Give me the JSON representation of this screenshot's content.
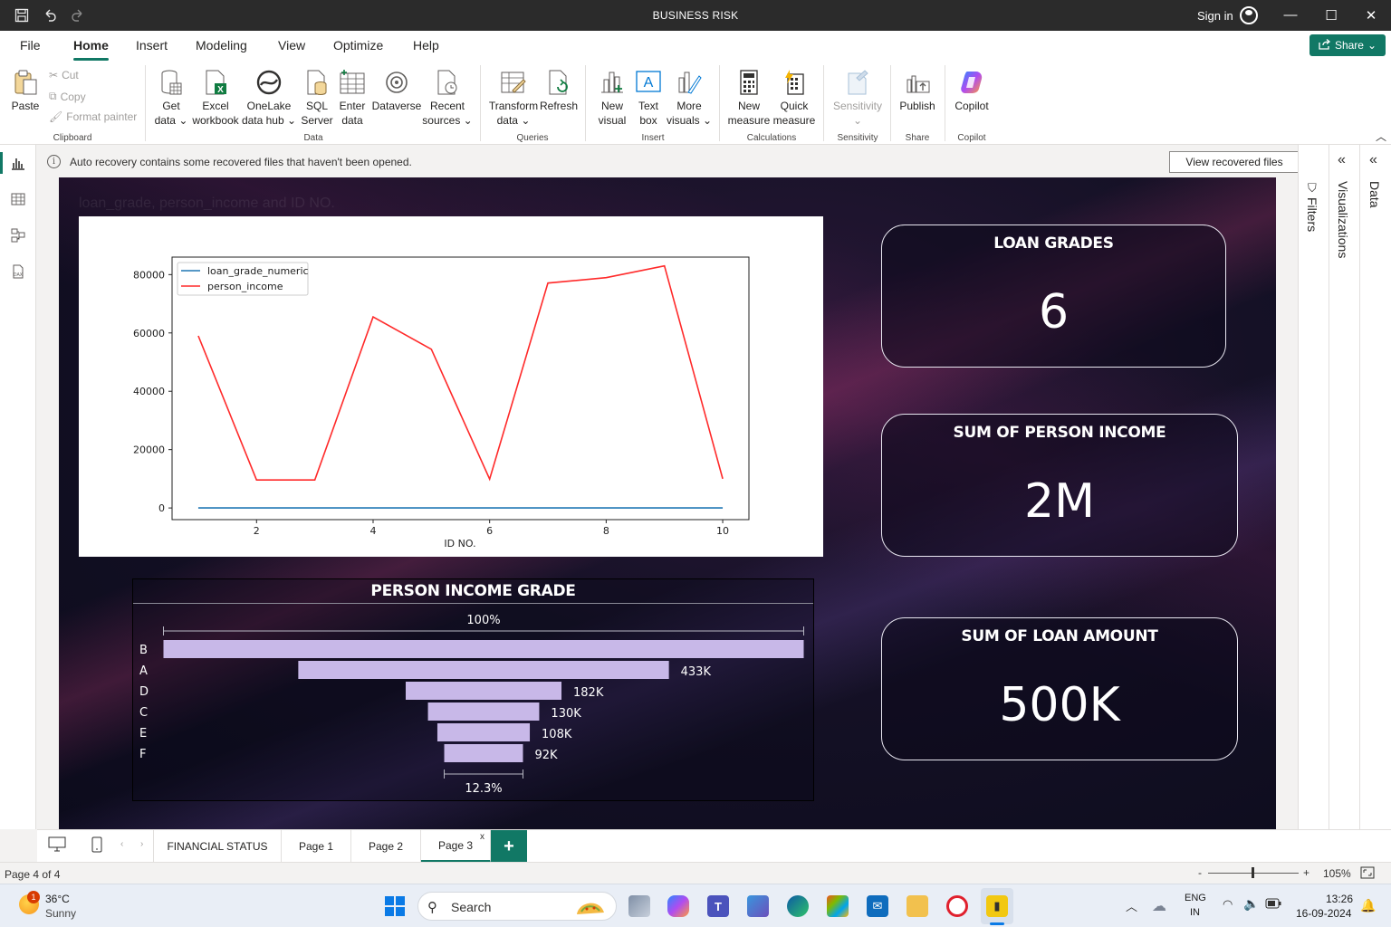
{
  "titlebar": {
    "title": "BUSINESS RISK",
    "signin": "Sign in",
    "minimize": "—",
    "maximize": "☐",
    "close": "✕"
  },
  "menu": {
    "tabs": [
      "File",
      "Home",
      "Insert",
      "Modeling",
      "View",
      "Optimize",
      "Help"
    ],
    "active": "Home",
    "share_label": "Share"
  },
  "ribbon": {
    "clipboard": {
      "paste": "Paste",
      "cut": "Cut",
      "copy": "Copy",
      "format_painter": "Format painter",
      "label": "Clipboard"
    },
    "data": {
      "get_data": [
        "Get",
        "data ⌄"
      ],
      "excel": [
        "Excel",
        "workbook"
      ],
      "onelake": [
        "OneLake",
        "data hub ⌄"
      ],
      "sql": [
        "SQL",
        "Server"
      ],
      "enter": [
        "Enter",
        "data"
      ],
      "dataverse": [
        "Dataverse",
        ""
      ],
      "recent": [
        "Recent",
        "sources ⌄"
      ],
      "label": "Data"
    },
    "queries": {
      "transform": [
        "Transform",
        "data ⌄"
      ],
      "refresh": [
        "Refresh",
        ""
      ],
      "label": "Queries"
    },
    "insert": {
      "new_visual": [
        "New",
        "visual"
      ],
      "text_box": [
        "Text",
        "box"
      ],
      "more_visuals": [
        "More",
        "visuals ⌄"
      ],
      "label": "Insert"
    },
    "calculations": {
      "new_measure": [
        "New",
        "measure"
      ],
      "quick_measure": [
        "Quick",
        "measure"
      ],
      "label": "Calculations"
    },
    "sensitivity": {
      "btn": [
        "Sensitivity",
        "⌄"
      ],
      "label": "Sensitivity"
    },
    "share": {
      "publish": "Publish",
      "label": "Share"
    },
    "copilot": {
      "btn": "Copilot",
      "label": "Copilot"
    }
  },
  "notification": {
    "message": "Auto recovery contains some recovered files that haven't been opened.",
    "button": "View recovered files"
  },
  "panes": {
    "filters": "Filters",
    "visualizations": "Visualizations",
    "data": "Data"
  },
  "canvas": {
    "ghost_title": "loan_grade, person_income and ID NO.",
    "cards": [
      {
        "title": "LOAN GRADES",
        "value": "6"
      },
      {
        "title": "SUM OF PERSON INCOME",
        "value": "2M"
      },
      {
        "title": "SUM OF LOAN AMOUNT",
        "value": "500K"
      }
    ]
  },
  "chart_data": [
    {
      "type": "line",
      "xlabel": "ID NO.",
      "ylabel": "",
      "x": [
        1,
        2,
        3,
        4,
        5,
        6,
        7,
        8,
        9,
        10
      ],
      "xlim": [
        0.55,
        10.45
      ],
      "ylim": [
        -4000,
        86000
      ],
      "x_ticks": [
        2,
        4,
        6,
        8,
        10
      ],
      "y_ticks": [
        0,
        20000,
        40000,
        60000,
        80000
      ],
      "legend_position": "top-left",
      "series": [
        {
          "name": "loan_grade_numeric",
          "color": "#1f77b4",
          "values": [
            0,
            0,
            0,
            0,
            0,
            0,
            0,
            0,
            0,
            0
          ]
        },
        {
          "name": "person_income",
          "color": "#ff2a2a",
          "values": [
            59000,
            9600,
            9600,
            65500,
            54400,
            9900,
            77100,
            78950,
            83000,
            10000
          ]
        }
      ]
    },
    {
      "type": "funnel",
      "title": "PERSON INCOME GRADE",
      "categories": [
        "B",
        "A",
        "D",
        "C",
        "E",
        "F"
      ],
      "values": [
        748000,
        433000,
        182000,
        130000,
        108000,
        92000
      ],
      "labels": [
        "",
        "433K",
        "182K",
        "130K",
        "108K",
        "92K"
      ],
      "top_percent": "100%",
      "bottom_percent": "12.3%",
      "bar_color": "#c8b8e8"
    }
  ],
  "page_tabs": [
    "FINANCIAL STATUS",
    "Page 1",
    "Page 2",
    "Page 3"
  ],
  "active_page": "Page 3",
  "status": {
    "page_indicator": "Page 4 of 4",
    "zoom": "105%",
    "minus": "-",
    "plus": "+"
  },
  "taskbar": {
    "weather_temp": "36°C",
    "weather_desc": "Sunny",
    "weather_badge": "1",
    "search": "Search",
    "lang": [
      "ENG",
      "IN"
    ],
    "time": "13:26",
    "date": "16-09-2024"
  }
}
